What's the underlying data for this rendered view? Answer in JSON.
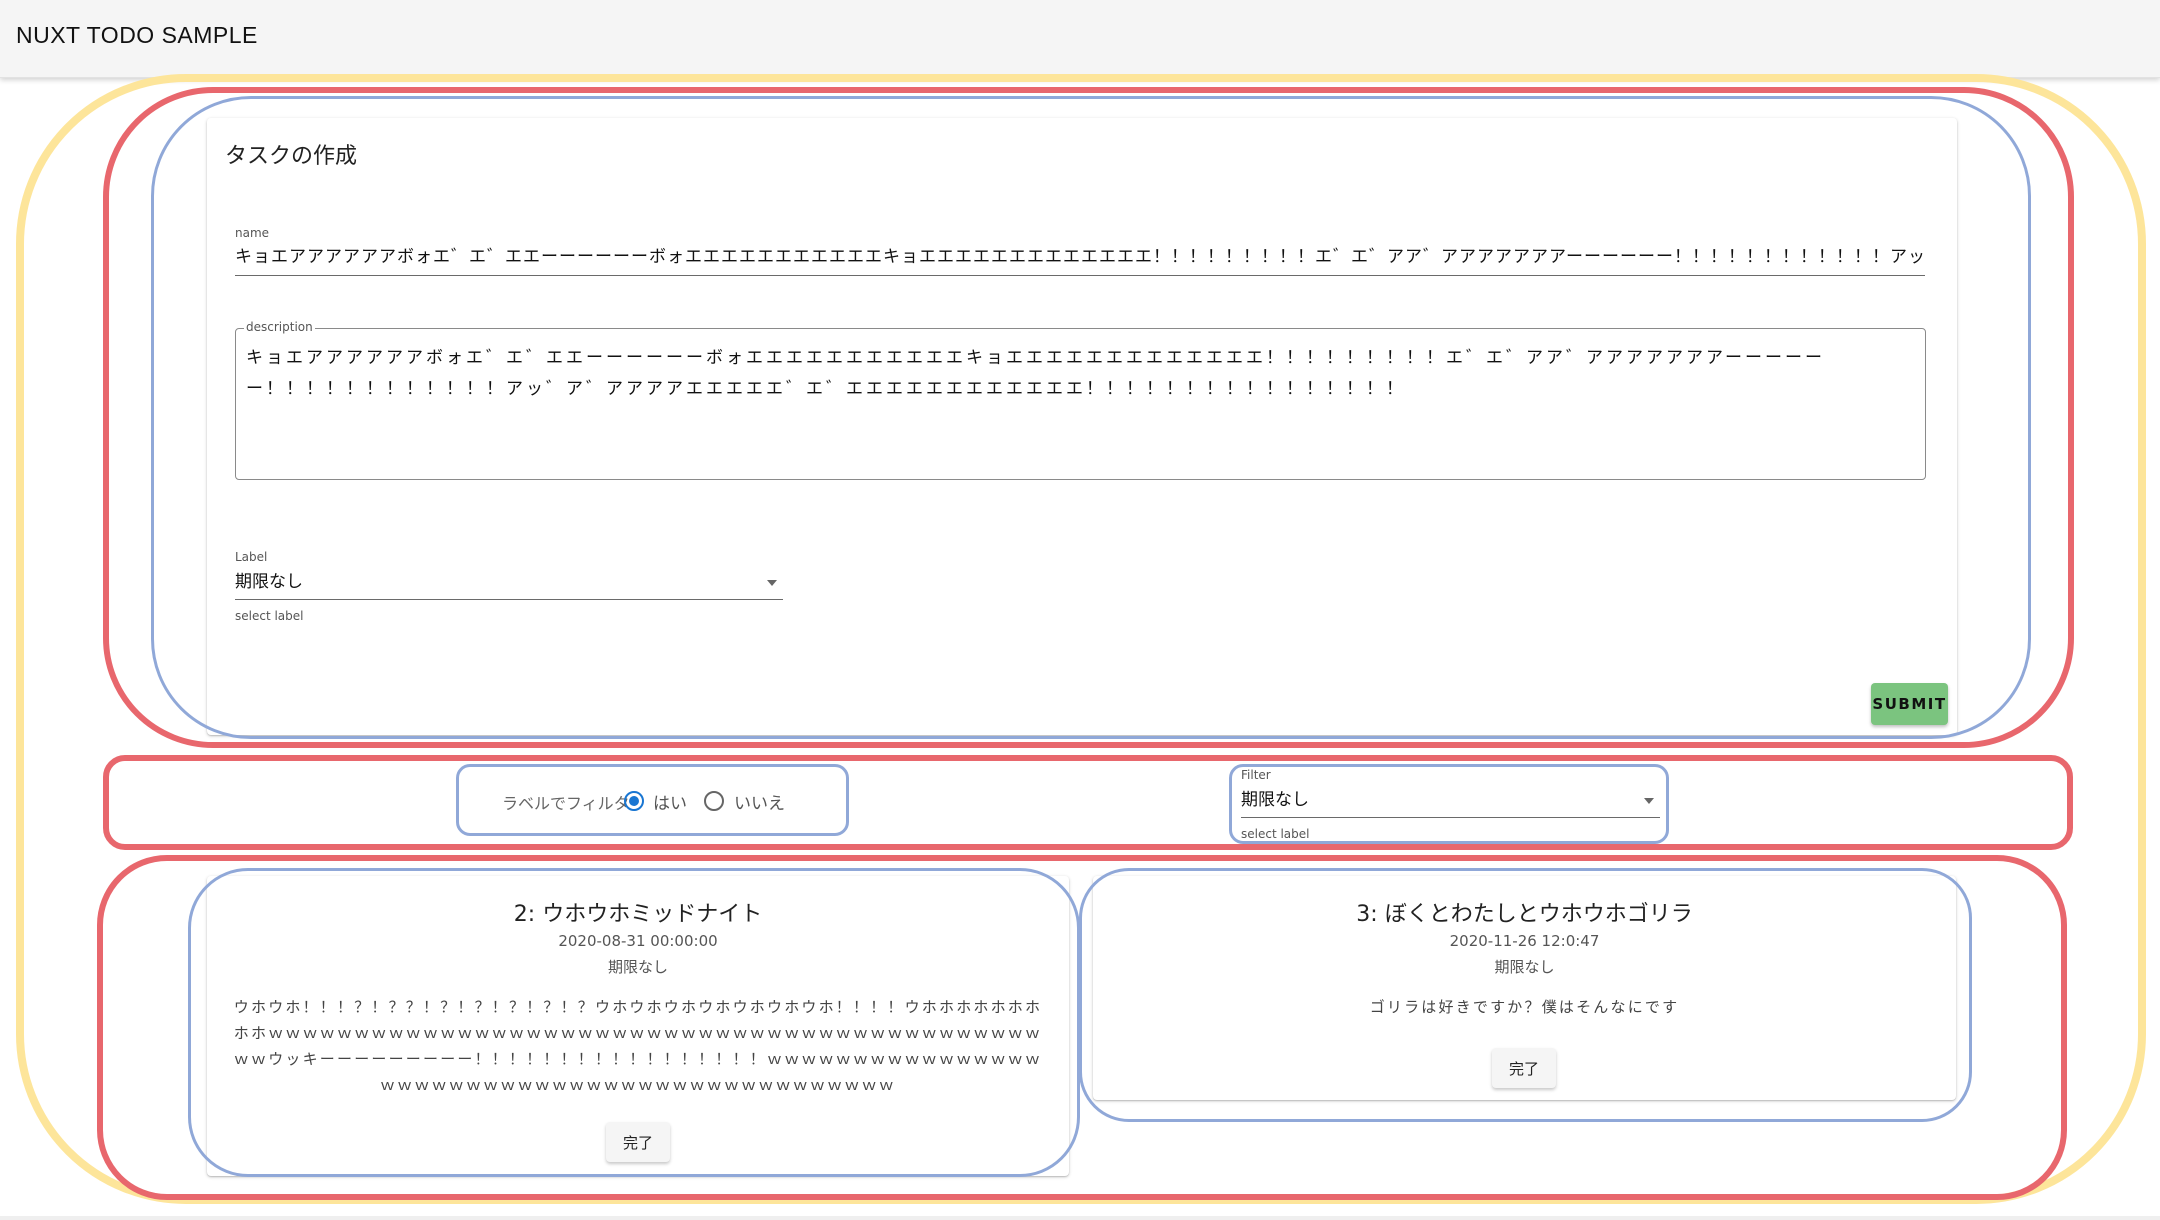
{
  "app": {
    "title": "NUXT TODO SAMPLE"
  },
  "create_form": {
    "title": "タスクの作成",
    "name_label": "name",
    "name_value": "キョエアアアアアアボォエ゛エ゛エエーーーーーーボォエエエエエエエエエエエキョエエエエエエエエエエエエエ！！！！！！！！！エ゛エ゛アア゛アアアアアアアーーーーーー！！！！！！！！！！！！アッ゛ア゛アアアアエエエエエ゛エ゛エエエエエエエエエエエエ！！！！！！！！！！！！！！！！",
    "description_label": "description",
    "description_value": "キョエアアアアアアボォエ゛エ゛エエーーーーーーボォエエエエエエエエエエエキョエエエエエエエエエエエエエ！！！！！！！！！エ゛エ゛アア゛アアアアアアアーーーーーー！！！！！！！！！！！！アッ゛ア゛アアアアエエエエエ゛エ゛エエエエエエエエエエエエ！！！！！！！！！！！！！！！！",
    "label_label": "Label",
    "label_value": "期限なし",
    "label_hint": "select label",
    "submit_label": "SUBMIT"
  },
  "filter": {
    "radio_group_label": "ラベルでフィルタ",
    "options": [
      "はい",
      "いいえ"
    ],
    "selected": "はい",
    "select_label": "Filter",
    "select_value": "期限なし",
    "select_hint": "select label"
  },
  "tasks": [
    {
      "id": "2",
      "name": "ウホウホミッドナイト",
      "datetime": "2020-08-31 00:00:00",
      "label": "期限なし",
      "description": "ウホウホ！！！？！？？！？！？！？！？！？ウホウホウホウホウホウホウホ！！！！ウホホホホホホホホホｗｗｗｗｗｗｗｗｗｗｗｗｗｗｗｗｗｗｗｗｗｗｗｗｗｗｗｗｗｗｗｗｗｗｗｗｗｗｗｗｗｗｗｗｗｗｗウッキーーーーーーーーー！！！！！！！！！！！！！！！！！ｗｗｗｗｗｗｗｗｗｗｗｗｗｗｗｗｗｗｗｗｗｗｗｗｗｗｗｗｗｗｗｗｗｗｗｗｗｗｗｗｗｗｗｗｗｗ",
      "done_label": "完了"
    },
    {
      "id": "3",
      "name": "ぼくとわたしとウホウホゴリラ",
      "datetime": "2020-11-26 12:0:47",
      "label": "期限なし",
      "description": "ゴリラは好きですか？僕はそんなにです",
      "done_label": "完了"
    }
  ],
  "colors": {
    "annotation_yellow": "#fde59a",
    "annotation_red": "#e8676d",
    "annotation_blue": "#90a8d8",
    "submit_green": "#7bc47f",
    "radio_blue": "#1976d2"
  }
}
